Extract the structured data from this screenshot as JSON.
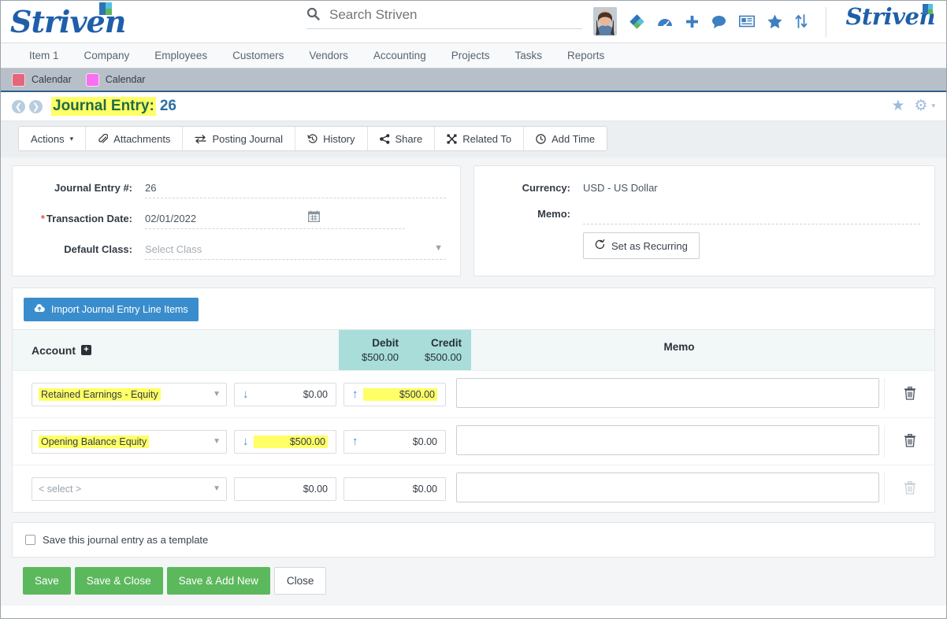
{
  "header": {
    "logo_text": "Striven",
    "logo_right_text": "Striven",
    "search": {
      "placeholder": "Search Striven",
      "value": ""
    },
    "icons": [
      {
        "name": "avatar",
        "glyph": ""
      },
      {
        "name": "diamond-logo-icon",
        "glyph": "◆"
      },
      {
        "name": "dashboard-gauge-icon",
        "glyph": "◔"
      },
      {
        "name": "add-plus-icon",
        "glyph": "✚"
      },
      {
        "name": "chat-bubble-icon",
        "glyph": "💬"
      },
      {
        "name": "news-card-icon",
        "glyph": "▤"
      },
      {
        "name": "favorites-star-icon",
        "glyph": "★"
      },
      {
        "name": "sort-arrows-icon",
        "glyph": "↑↓"
      }
    ]
  },
  "nav": {
    "items": [
      "Item 1",
      "Company",
      "Employees",
      "Customers",
      "Vendors",
      "Accounting",
      "Projects",
      "Tasks",
      "Reports"
    ]
  },
  "tabstrip": {
    "tabs": [
      {
        "label": "Calendar",
        "color": "#e2677c"
      },
      {
        "label": "Calendar",
        "color": "#f571ef"
      }
    ]
  },
  "page_title": {
    "back_glyph": "❮",
    "forward_glyph": "❯",
    "label": "Journal Entry:",
    "number": "26",
    "star_glyph": "★",
    "gear_glyph": "⚙",
    "caret_glyph": "▾"
  },
  "toolbar": {
    "buttons": [
      {
        "label": "Actions",
        "icon": "",
        "caret": "▾"
      },
      {
        "label": "Attachments",
        "icon": "📎"
      },
      {
        "label": "Posting Journal",
        "icon": "⇄"
      },
      {
        "label": "History",
        "icon": "↺"
      },
      {
        "label": "Share",
        "icon": "❮"
      },
      {
        "label": "Related To",
        "icon": "✥"
      },
      {
        "label": "Add Time",
        "icon": "◴"
      }
    ]
  },
  "form_left": {
    "journal_entry_number_label": "Journal Entry #:",
    "journal_entry_number_value": "26",
    "transaction_date_label": "Transaction Date:",
    "transaction_date_value": "02/01/2022",
    "transaction_date_required": "*",
    "calendar_icon": "▦",
    "default_class_label": "Default Class:",
    "default_class_placeholder": "Select Class",
    "default_class_value": ""
  },
  "form_right": {
    "currency_label": "Currency:",
    "currency_value": "USD - US Dollar",
    "memo_label": "Memo:",
    "memo_value": "",
    "set_recurring_label": "Set as Recurring",
    "set_recurring_icon": "↻"
  },
  "line_items": {
    "import_button_label": "Import Journal Entry Line Items",
    "import_button_icon": "☁",
    "columns": {
      "account": "Account",
      "account_add_glyph": "+",
      "debit": "Debit",
      "credit": "Credit",
      "memo": "Memo"
    },
    "totals": {
      "debit": "$500.00",
      "credit": "$500.00"
    },
    "rows": [
      {
        "account": "Retained Earnings - Equity",
        "account_highlighted": true,
        "account_placeholder": false,
        "debit": "$0.00",
        "debit_highlighted": false,
        "credit": "$500.00",
        "credit_highlighted": true,
        "debit_arrow": "↓",
        "credit_arrow": "↑",
        "memo": "",
        "delete_icon": "🗑",
        "delete_enabled": true
      },
      {
        "account": "Opening Balance Equity",
        "account_highlighted": true,
        "account_placeholder": false,
        "debit": "$500.00",
        "debit_highlighted": true,
        "credit": "$0.00",
        "credit_highlighted": false,
        "debit_arrow": "↓",
        "credit_arrow": "↑",
        "memo": "",
        "delete_icon": "🗑",
        "delete_enabled": true
      },
      {
        "account": "< select >",
        "account_highlighted": false,
        "account_placeholder": true,
        "debit": "$0.00",
        "debit_highlighted": false,
        "credit": "$0.00",
        "credit_highlighted": false,
        "debit_arrow": "",
        "credit_arrow": "",
        "memo": "",
        "delete_icon": "🗑",
        "delete_enabled": false
      }
    ],
    "dropdown_caret": "▼"
  },
  "footer": {
    "template_checkbox_label": "Save this journal entry as a template",
    "template_checked": false,
    "buttons": [
      {
        "label": "Save",
        "style": "green"
      },
      {
        "label": "Save & Close",
        "style": "green"
      },
      {
        "label": "Save & Add New",
        "style": "green"
      },
      {
        "label": "Close",
        "style": "white"
      }
    ]
  },
  "colors": {
    "brand_blue": "#1f5fa9",
    "accent_blue": "#3a8dcc",
    "teal_header": "#a8ddd9",
    "green_button": "#5cb85c",
    "highlight_yellow": "#ffff66",
    "title_green": "#1f6b47"
  }
}
